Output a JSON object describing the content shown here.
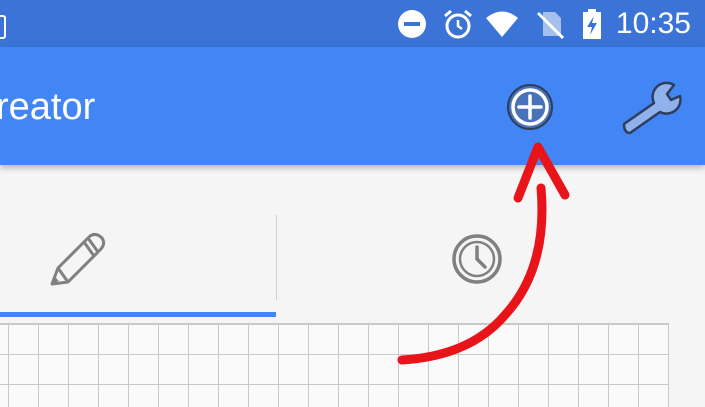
{
  "status_bar": {
    "time": "10:35",
    "icons": [
      "do-not-disturb-icon",
      "alarm-icon",
      "wifi-icon",
      "no-sim-icon",
      "battery-charging-icon"
    ]
  },
  "app_bar": {
    "title": "reator",
    "actions": [
      "add-circle-icon",
      "wrench-icon"
    ]
  },
  "tabs": [
    {
      "icon": "pencil-icon",
      "selected": true
    },
    {
      "icon": "clock-icon",
      "selected": false
    }
  ],
  "colors": {
    "status_bar": "#3b73d6",
    "app_bar": "#4285f4",
    "accent": "#4285f4",
    "annotation": "#e8141a"
  }
}
